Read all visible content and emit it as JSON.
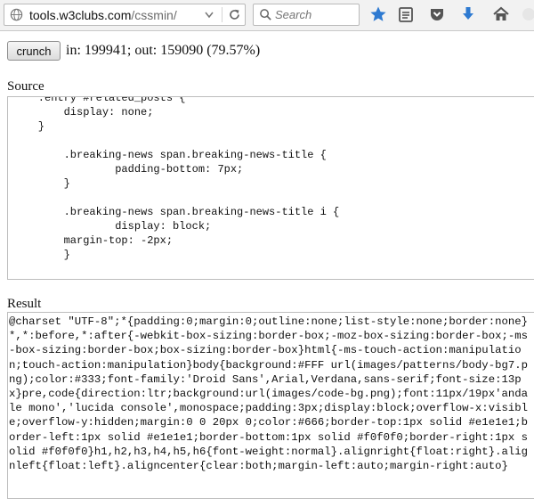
{
  "browser": {
    "url_domain": "tools.w3clubs.com",
    "url_path": "/cssmin/",
    "search_placeholder": "Search"
  },
  "toolbar": {
    "crunch_label": "crunch",
    "stats": "in: 199941; out: 159090 (79.57%)"
  },
  "source": {
    "label": "Source",
    "code": "    .entry #related_posts {\n        display: none;\n    }\n\n        .breaking-news span.breaking-news-title {\n                padding-bottom: 7px;\n        }\n\n        .breaking-news span.breaking-news-title i {\n                display: block;\n        margin-top: -2px;\n        }"
  },
  "result": {
    "label": "Result",
    "code": "@charset \"UTF-8\";*{padding:0;margin:0;outline:none;list-style:none;border:none}*,*:before,*:after{-webkit-box-sizing:border-box;-moz-box-sizing:border-box;-ms-box-sizing:border-box;box-sizing:border-box}html{-ms-touch-action:manipulation;touch-action:manipulation}body{background:#FFF url(images/patterns/body-bg7.png);color:#333;font-family:'Droid Sans',Arial,Verdana,sans-serif;font-size:13px}pre,code{direction:ltr;background:url(images/code-bg.png);font:11px/19px'andale mono','lucida console',monospace;padding:3px;display:block;overflow-x:visible;overflow-y:hidden;margin:0 0 20px 0;color:#666;border-top:1px solid #e1e1e1;border-left:1px solid #e1e1e1;border-bottom:1px solid #f0f0f0;border-right:1px solid #f0f0f0}h1,h2,h3,h4,h5,h6{font-weight:normal}.alignright{float:right}.alignleft{float:left}.aligncenter{clear:both;margin-left:auto;margin-right:auto}"
  }
}
